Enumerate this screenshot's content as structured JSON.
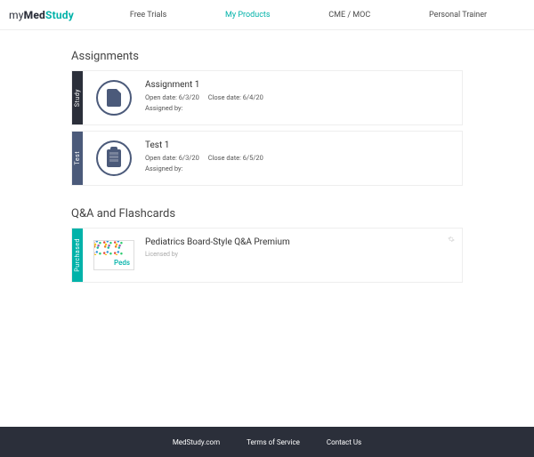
{
  "brand": {
    "my": "my",
    "med": "Med",
    "study": "Study"
  },
  "nav": {
    "free_trials": "Free Trials",
    "my_products": "My Products",
    "cme_moc": "CME / MOC",
    "personal_trainer": "Personal Trainer"
  },
  "sections": {
    "assignments": "Assignments",
    "qanda": "Q&A and Flashcards"
  },
  "rails": {
    "study": "Study",
    "test": "Test",
    "purchased": "Purchased"
  },
  "assignment1": {
    "title": "Assignment 1",
    "open": "Open date: 6/3/20",
    "close": "Close date: 6/4/20",
    "assigned": "Assigned by:"
  },
  "test1": {
    "title": "Test 1",
    "open": "Open date: 6/3/20",
    "close": "Close date: 6/5/20",
    "assigned": "Assigned by:"
  },
  "peds": {
    "title": "Pediatrics Board-Style Q&A Premium",
    "licensed": "Licensed by",
    "thumb_label": "Peds"
  },
  "footer": {
    "site": "MedStudy.com",
    "tos": "Terms of Service",
    "contact": "Contact Us"
  }
}
